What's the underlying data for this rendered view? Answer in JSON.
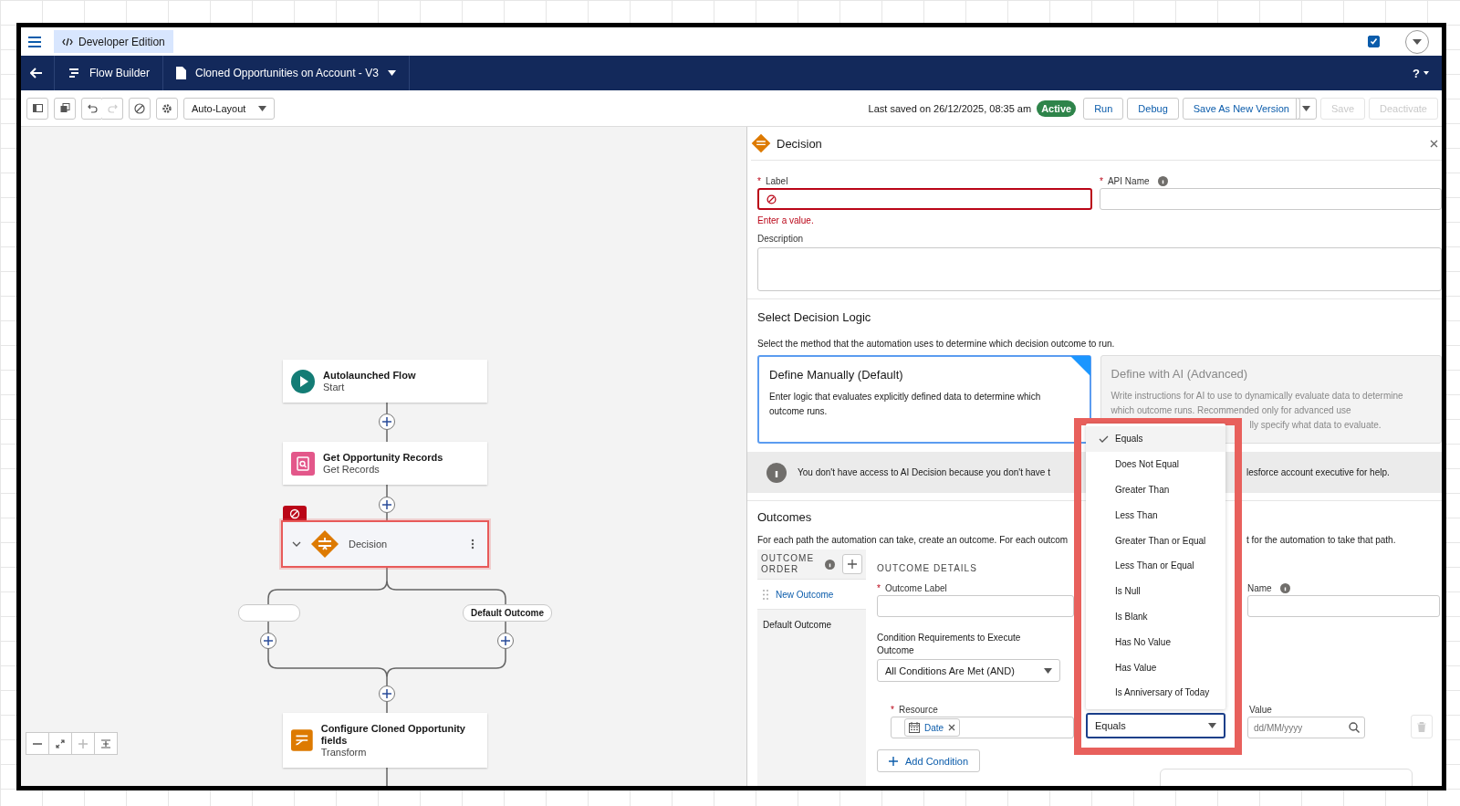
{
  "app_bar": {
    "org_label": "Developer Edition",
    "checkbox_checked": true
  },
  "nav_bar": {
    "app_name": "Flow Builder",
    "flow_name": "Cloned Opportunities on Account - V3",
    "help": "?"
  },
  "toolbar": {
    "layout_mode": "Auto-Layout",
    "redo_disabled": true,
    "last_saved": "Last saved on 26/12/2025, 08:35 am",
    "status": "Active",
    "buttons": [
      {
        "label": "Run",
        "disabled": false,
        "split": false
      },
      {
        "label": "Debug",
        "disabled": false,
        "split": false
      },
      {
        "label": "Save As New Version",
        "disabled": false,
        "split": true
      },
      {
        "label": "Save",
        "disabled": true,
        "split": false
      },
      {
        "label": "Deactivate",
        "disabled": true,
        "split": false
      }
    ]
  },
  "canvas": {
    "nodes": [
      {
        "kind": "start",
        "title": "Autolaunched Flow",
        "subtitle": "Start",
        "selected": false,
        "has_error": false
      },
      {
        "kind": "get_records",
        "title": "Get Opportunity Records",
        "subtitle": "Get Records",
        "selected": false,
        "has_error": false
      },
      {
        "kind": "decision",
        "title": "Decision",
        "selected": true,
        "has_error": true
      },
      {
        "kind": "transform",
        "title": "Configure Cloned Opportunity fields",
        "subtitle": "Transform",
        "selected": false,
        "has_error": false
      }
    ],
    "branches": [
      {
        "named": false
      },
      {
        "named": true,
        "label": "Default Outcome"
      }
    ]
  },
  "panel": {
    "title": "Decision",
    "required_mark": "*",
    "label_field": {
      "label": "Label",
      "required": true,
      "invalid": true,
      "error": "Enter a value."
    },
    "api_name_field": {
      "label": "API Name",
      "required": true
    },
    "description_label": "Description",
    "logic": {
      "heading": "Select Decision Logic",
      "intro": "Select the method that the automation uses to determine which decision outcome to run.",
      "options": [
        {
          "title": "Define Manually (Default)",
          "text": "Enter logic that evaluates explicitly defined data to determine which outcome runs.",
          "selected": true,
          "disabled": false
        },
        {
          "title": "Define with AI (Advanced)",
          "text": "Write instructions for AI to use to dynamically evaluate data to determine which outcome runs. Recommended only for advanced use",
          "text_tail": "lly specify what data to evaluate.",
          "selected": false,
          "disabled": true
        }
      ],
      "notice_left": "You don't have access to AI Decision because you don't have t",
      "notice_right": "lesforce account executive for help."
    },
    "outcomes": {
      "heading": "Outcomes",
      "intro_left": "For each path the automation can take, create an outcome. For each outcom",
      "intro_right": "t for the automation to take that path.",
      "order_label": "OUTCOME ORDER",
      "items": [
        {
          "label": "New Outcome",
          "selected": true
        },
        {
          "label": "Default Outcome",
          "selected": false
        }
      ],
      "details_heading": "OUTCOME DETAILS",
      "outcome_label": "Outcome Label",
      "outcome_label_required": true,
      "api_name_label": "Name",
      "condition_label": "Condition Requirements to Execute Outcome",
      "condition_value": "All Conditions Are Met (AND)",
      "resource_label": "Resource",
      "resource_required": true,
      "resource_value": "Date",
      "operator_value": "Equals",
      "value_label": "Value",
      "value_placeholder": "dd/MM/yyyy",
      "add_condition": "Add Condition"
    },
    "operator_menu": [
      {
        "label": "Equals",
        "selected": true
      },
      {
        "label": "Does Not Equal",
        "selected": false
      },
      {
        "label": "Greater Than",
        "selected": false
      },
      {
        "label": "Less Than",
        "selected": false
      },
      {
        "label": "Greater Than or Equal",
        "selected": false
      },
      {
        "label": "Less Than or Equal",
        "selected": false
      },
      {
        "label": "Is Null",
        "selected": false
      },
      {
        "label": "Is Blank",
        "selected": false
      },
      {
        "label": "Has No Value",
        "selected": false
      },
      {
        "label": "Has Value",
        "selected": false
      },
      {
        "label": "Is Anniversary of Today",
        "selected": false
      }
    ]
  }
}
